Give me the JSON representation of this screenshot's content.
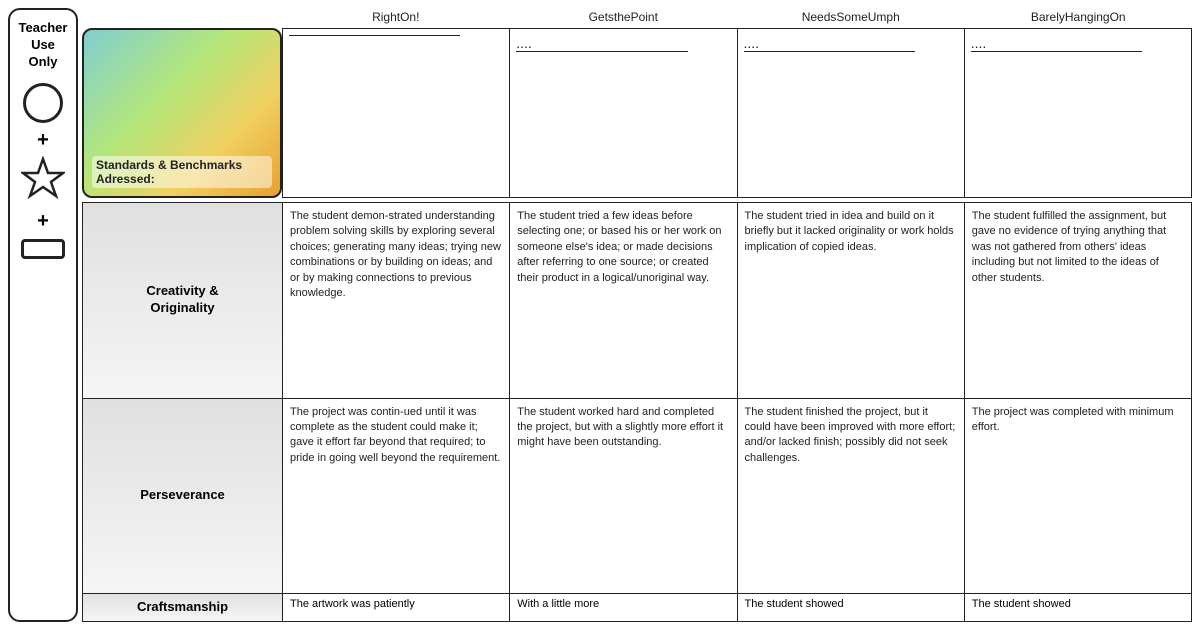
{
  "header": {
    "col1": "RightOn!",
    "col2": "GetsthePoint",
    "col3": "NeedsSomeUmph",
    "col4": "BarelyHangingOn"
  },
  "standards": {
    "label": "Standards & Benchmarks Adressed:"
  },
  "grade_cols": [
    {
      "line": true,
      "dots": ""
    },
    {
      "line": false,
      "dots": "...."
    },
    {
      "line": false,
      "dots": "...."
    },
    {
      "line": false,
      "dots": "...."
    }
  ],
  "teacher_use": {
    "label": "Teacher\nUse Only"
  },
  "rubric_rows": [
    {
      "criteria": "Creativity &\nOriginality",
      "cells": [
        "The student demon-strated understanding problem solving skills by exploring several choices; generating many ideas; trying new combinations or by building on ideas; and or by making connections to previous knowledge.",
        "The student tried a few ideas before selecting one; or based his or her work on someone else's idea; or made decisions after referring to one source; or created their product in a logical/unoriginal way.",
        "The student tried in idea and build on it briefly but it lacked originality or work holds implication of copied ideas.",
        "The student fulfilled the assignment, but gave no evidence of trying anything that was not gathered from others' ideas including but not limited to the ideas of other students."
      ]
    },
    {
      "criteria": "Perseverance",
      "cells": [
        "The project was contin-ued until it was complete as the student could make it; gave it effort far beyond that required; to pride in going well beyond the requirement.",
        "The student worked hard and completed the project, but with a slightly more effort it might have been outstanding.",
        "The student finished the project, but it could have been improved with more effort; and/or lacked finish; possibly did not seek challenges.",
        "The project was completed with minimum effort."
      ]
    }
  ],
  "craftsmanship_row": {
    "criteria": "Craftsmanship",
    "cells": [
      "The artwork was patiently",
      "With a little more",
      "The student showed",
      "The student showed"
    ]
  }
}
